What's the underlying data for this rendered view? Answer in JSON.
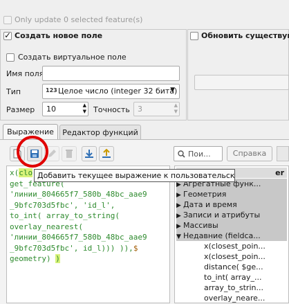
{
  "top": {
    "only_update_label": "Only update 0 selected feature(s)"
  },
  "create_field": {
    "title": "Создать новое поле",
    "virtual_label": "Создать виртуальное поле",
    "name_label": "Имя поля",
    "name_value": "",
    "type_label": "Тип",
    "type_badge": "123",
    "type_value": "Целое число (integer 32 бита)",
    "size_label": "Размер",
    "size_value": "10",
    "precision_label": "Точность",
    "precision_value": "3"
  },
  "update_existing": {
    "title": "Обновить существую"
  },
  "tabs": {
    "expression": "Выражение",
    "function_editor": "Редактор функций"
  },
  "toolbar": {
    "tooltip": "Добавить текущее выражение к пользовательским",
    "search_placeholder": "Пои...",
    "help_label": "Справка"
  },
  "code": {
    "l1a": "x(",
    "l1b": "clo",
    "l2": "get_feature(",
    "l3": "'линии_804665f7_580b_48bc_aae9",
    "l4": "_9bfc703d5fbc', 'id_l',",
    "l5": "to_int( array_to_string(",
    "l6": "overlay_nearest(",
    "l7": "'линии_804665f7_580b_48bc_aae9",
    "l8": "_9bfc703d5fbc', id_l))) )),",
    "l8b": "$",
    "l9": "geometry) ",
    "l9b": ")"
  },
  "tree": {
    "header": "er",
    "items": [
      {
        "label": "Агрегатные функ..."
      },
      {
        "label": "Геометрия"
      },
      {
        "label": "Дата и время"
      },
      {
        "label": "Записи и атрибуты"
      },
      {
        "label": "Массивы"
      },
      {
        "label": "Недавние (fieldca..."
      }
    ],
    "children": [
      {
        "label": "x(closest_poin..."
      },
      {
        "label": "x(closest_poin..."
      },
      {
        "label": "distance( $ge..."
      },
      {
        "label": "to_int( array_..."
      },
      {
        "label": "array_to_strin..."
      },
      {
        "label": "overlay_neare..."
      }
    ]
  },
  "colors": {
    "annotation_circle": "#e00000",
    "code_green": "#2d8a2d",
    "highlight_yellow": "#d8f27a",
    "tree_highlight": "#c8c8c8"
  }
}
